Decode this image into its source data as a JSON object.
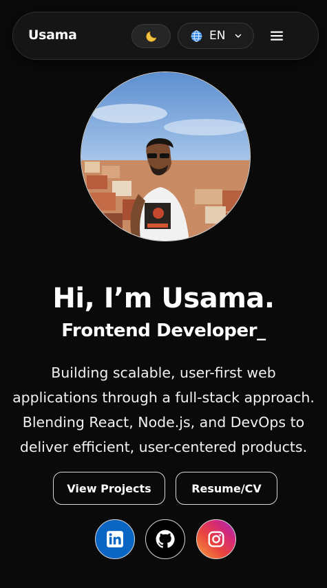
{
  "nav": {
    "brand": "Usama",
    "theme_icon": "moon-icon",
    "language": {
      "icon": "globe-icon",
      "selected": "EN",
      "chevron": "chevron-down-icon"
    },
    "menu_icon": "hamburger-menu-icon"
  },
  "hero": {
    "avatar": "profile-photo",
    "title": "Hi, I’m Usama.",
    "role": "Frontend Developer",
    "cursor": "_",
    "description": "Building scalable, user-first web applications through a full-stack approach. Blending React, Node.js, and DevOps to deliver efficient, user-centered products."
  },
  "actions": {
    "projects_label": "View Projects",
    "resume_label": "Resume/CV"
  },
  "social": [
    {
      "name": "linkedin-icon",
      "color": "#0a66c2"
    },
    {
      "name": "github-icon",
      "color": "#000000"
    },
    {
      "name": "instagram-icon",
      "color": "#d62976"
    }
  ],
  "colors": {
    "background": "#0a0a0a",
    "text": "#ffffff",
    "navbar": "#151515"
  }
}
